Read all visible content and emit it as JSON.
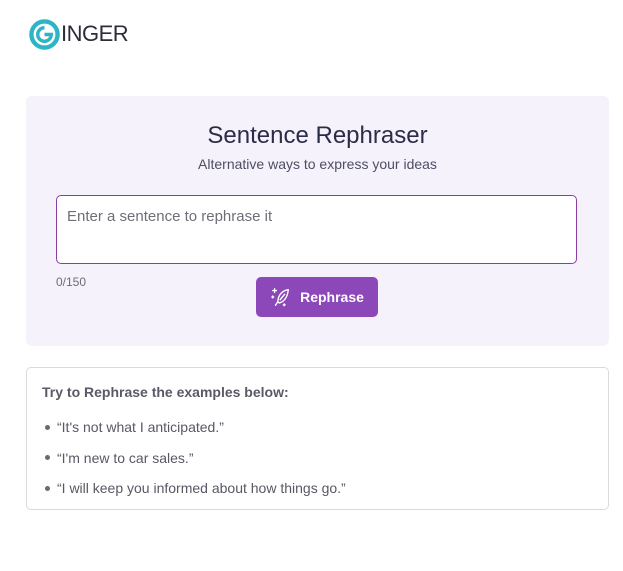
{
  "brand": {
    "logo_text": "INGER",
    "logo_letter": "G",
    "accent_color": "#2bb5c5"
  },
  "rephraser": {
    "title": "Sentence Rephraser",
    "subtitle": "Alternative ways to express your ideas",
    "input": {
      "value": "",
      "placeholder": "Enter a sentence to rephrase it"
    },
    "counter": "0/150",
    "button_label": "Rephrase",
    "button_icon": "magic-quill-icon",
    "button_color": "#8c47b8",
    "card_background": "#f5f2fb"
  },
  "examples": {
    "title": "Try to Rephrase the examples below:",
    "items": [
      "“It's not what I anticipated.”",
      "“I'm new to car sales.”",
      "“I will keep you informed about how things go.”"
    ]
  }
}
